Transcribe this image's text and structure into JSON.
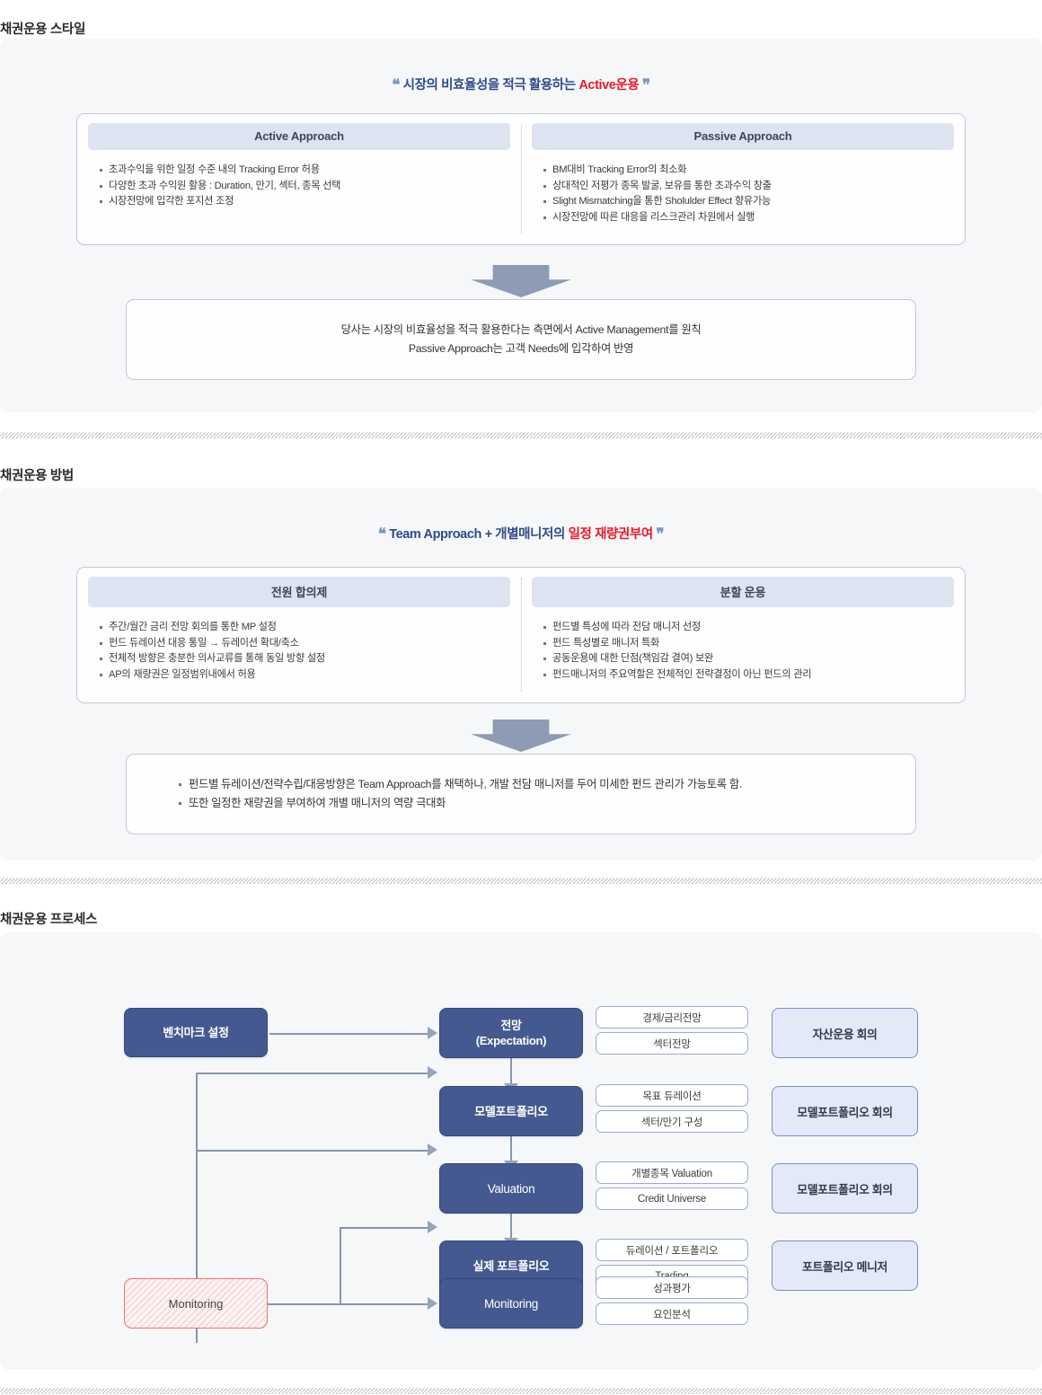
{
  "sections": [
    {
      "title": "채권운용 스타일",
      "quote": {
        "pre": "시장의 비효율성을 적극 활용하는 ",
        "highlight": "Active운용"
      },
      "panels": [
        {
          "header": "Active Approach",
          "items": [
            "초과수익을 위한 일정 수준 내의 Tracking Error 허용",
            "다양한 초과 수익원 활용 : Duration, 만기, 섹터,  종목 선택",
            "시장전망에 입각한 포지션 조정"
          ]
        },
        {
          "header": "Passive Approach",
          "items": [
            "BM대비 Tracking Error의 최소화",
            "상대적인 저평가 종목 발굴, 보유를 통한 초과수익 창출",
            "Slight Mismatching을 통한 Sholulder Effect 향유가능",
            "시장전망에 따른 대응을 리스크관리 차원에서 실행"
          ]
        }
      ],
      "conclusion": [
        "당사는 시장의 비효율성을 적극 활용한다는 측면에서 Active Management를 원칙",
        "Passive Approach는 고객 Needs에 입각하여 반영"
      ]
    },
    {
      "title": "채권운용 방법",
      "quote": {
        "pre": "Team Approach + 개별매니저의 ",
        "highlight": "일정 재량권부여"
      },
      "panels": [
        {
          "header": "전원 합의제",
          "items": [
            "주간/월간 금리 전망 회의를 통한 MP 설정",
            "펀드 듀레이션 대응 통일 → 듀레이션 확대/축소",
            "전체적 방향은 충분한 의사교류를 통해 동일 방향 설정",
            "AP의 재량권은 일정범위내에서 허용"
          ]
        },
        {
          "header": "분할 운용",
          "items": [
            "펀드별 특성에 따라 전담 매니저 선정",
            "펀드 특성별로 매니저 특화",
            "공동운용에 대한 단점(책임감 결여) 보완",
            "펀드매니저의 주요역할은 전체적인 전략결정이 아닌 펀드의 관리"
          ]
        }
      ],
      "conclusion": [
        "펀드별 듀레이션/전략수립/대응방향은 Team Approach를 채택하나, 개발 전담 매니저를 두어 미세한 펀드 관리가 가능토록 함.",
        "또한 일정한 재량권을 부여하여 개별 매니저의 역량 극대화"
      ]
    },
    {
      "title": "채권운용 프로세스"
    }
  ],
  "flow": {
    "benchmark_label": "벤치마크 설정",
    "monitoring_source_label": "Monitoring",
    "stages": [
      {
        "label": "전망\n(Expectation)",
        "label_line1": "전망",
        "label_line2": "(Expectation)",
        "pills": [
          "경제/금리전망",
          "섹터전망"
        ],
        "meeting": "자산운용 회의"
      },
      {
        "label": "모델포트폴리오",
        "pills": [
          "목표 듀레이션",
          "섹터/만기 구성"
        ],
        "meeting": "모델포트폴리오 회의"
      },
      {
        "label": "Valuation",
        "pills": [
          "개별종목 Valuation",
          "Credit Universe"
        ],
        "meeting": "모델포트폴리오 회의"
      },
      {
        "label": "실제 포트폴리오",
        "pills": [
          "듀레이션 / 포트폴리오",
          "Trading"
        ],
        "meeting": "포트폴리오 메니저"
      },
      {
        "label": "Monitoring",
        "pills": [
          "성과평가",
          "요인분석"
        ],
        "meeting": ""
      }
    ]
  },
  "colors": {
    "page_bg": "#ffffff",
    "card_bg": "#f6f7f8",
    "panel_head_bg": "#dde3f0",
    "quote_blue": "#2d4b8e",
    "quote_red": "#e8192c",
    "flow_box_blue": "#44598f",
    "meeting_box_bg": "#e3e9f7",
    "connector_grey": "#8795b0",
    "monitor_border_red": "#f2706e"
  }
}
